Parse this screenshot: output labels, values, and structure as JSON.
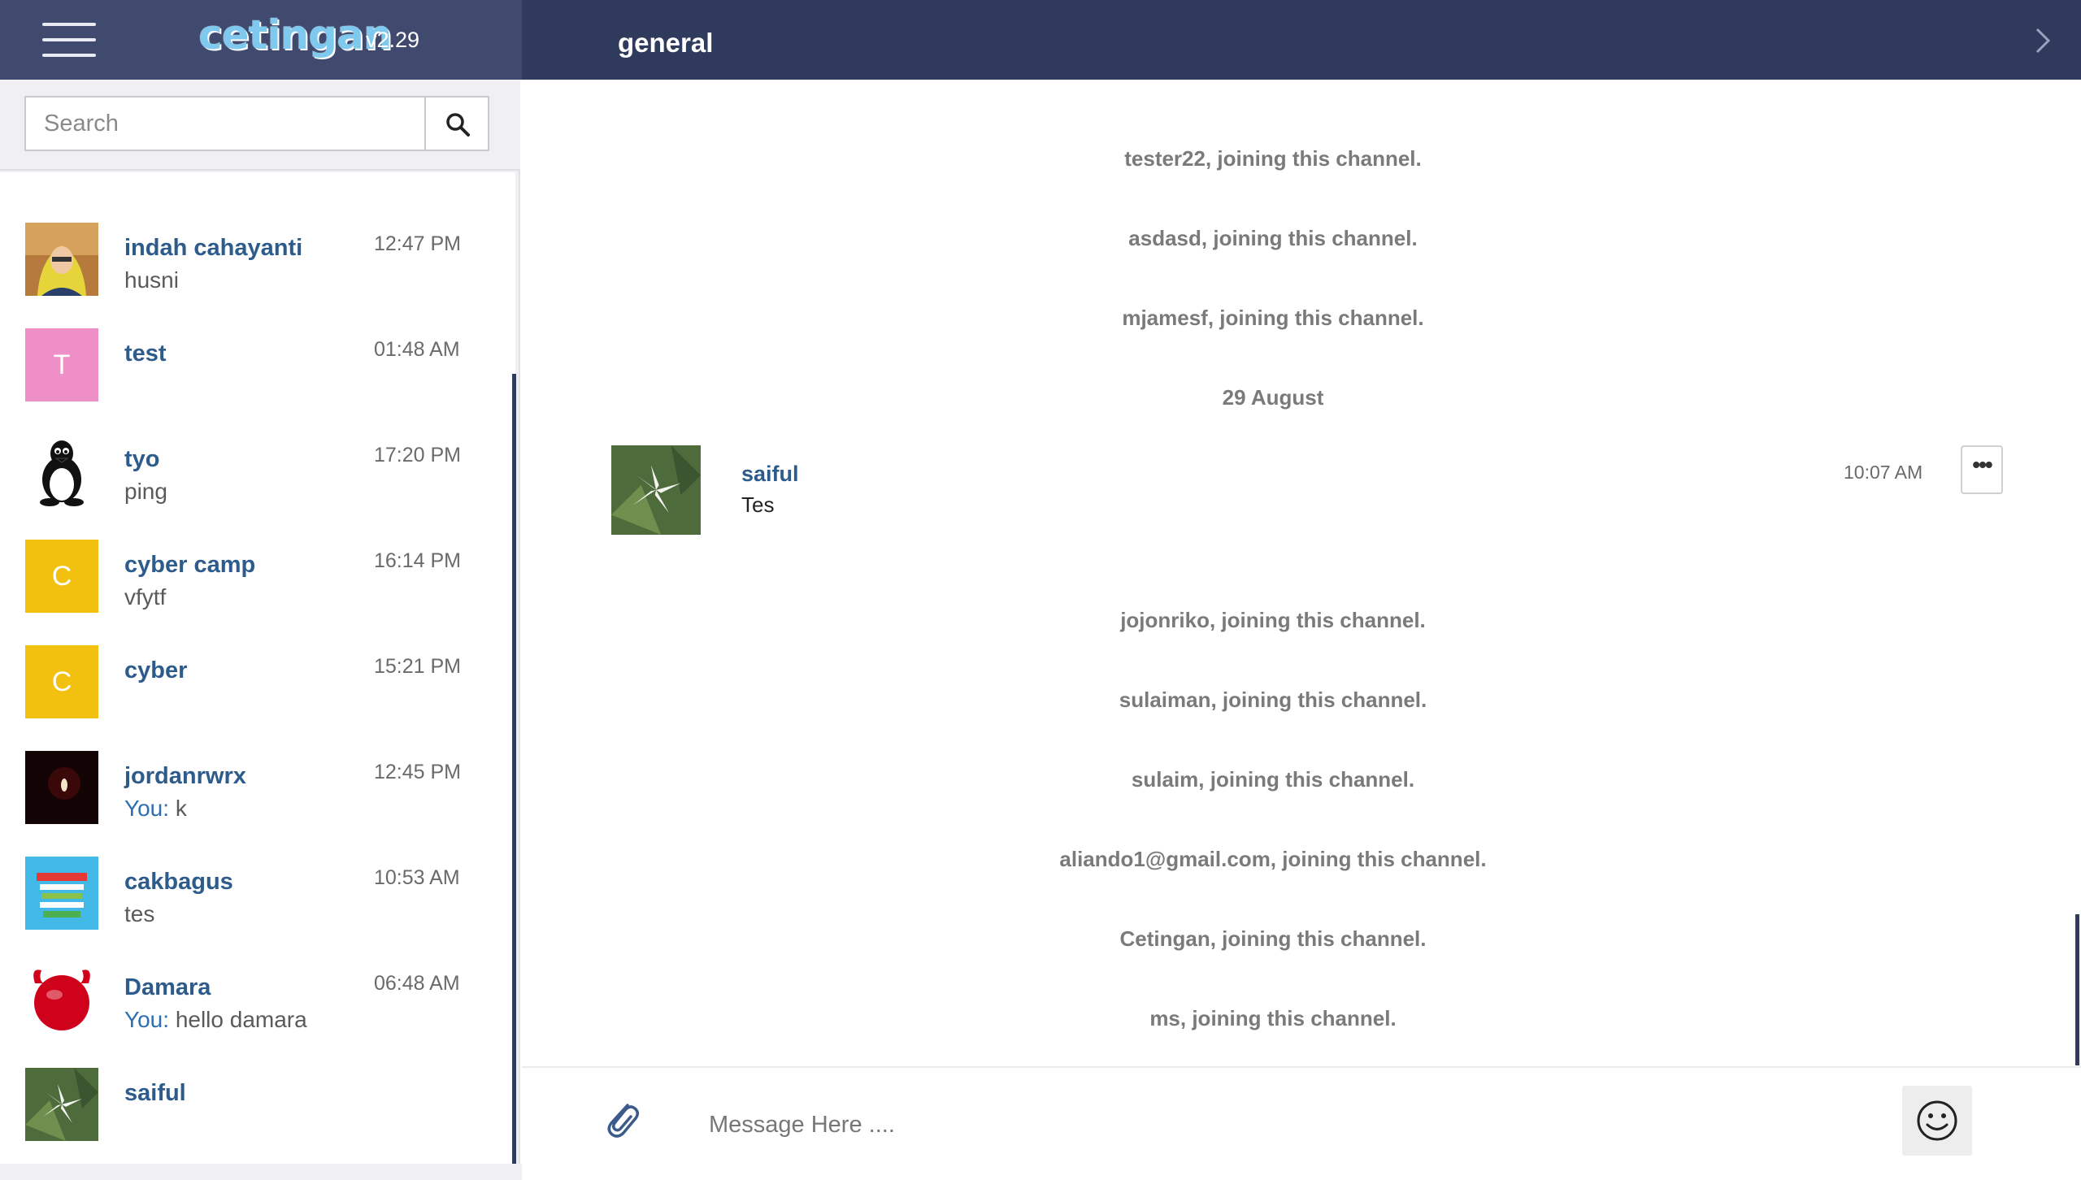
{
  "brand": {
    "name": "cetingan",
    "version": "v2.29"
  },
  "search": {
    "placeholder": "Search"
  },
  "conversations": [
    {
      "name": "indah cahayanti",
      "preview": "husni",
      "you": "",
      "time": "12:47 PM",
      "avatar": "photo"
    },
    {
      "name": "test",
      "preview": "",
      "you": "",
      "time": "01:48 AM",
      "avatar": "letter",
      "letter": "T",
      "color": "#ef8fc7"
    },
    {
      "name": "tyo",
      "preview": "ping",
      "you": "",
      "time": "17:20 PM",
      "avatar": "tux"
    },
    {
      "name": "cyber camp",
      "preview": "vfytf",
      "you": "",
      "time": "16:14 PM",
      "avatar": "letter",
      "letter": "C",
      "color": "#f2c10f"
    },
    {
      "name": "cyber",
      "preview": "",
      "you": "",
      "time": "15:21 PM",
      "avatar": "letter",
      "letter": "C",
      "color": "#f2c10f"
    },
    {
      "name": "jordanrwrx",
      "preview": "k",
      "you": "You:",
      "time": "12:45 PM",
      "avatar": "dark"
    },
    {
      "name": "cakbagus",
      "preview": "tes",
      "you": "",
      "time": "10:53 AM",
      "avatar": "poster"
    },
    {
      "name": "Damara",
      "preview": "hello damara",
      "you": "You:",
      "time": "06:48 AM",
      "avatar": "devil"
    },
    {
      "name": "saiful",
      "preview": "",
      "you": "",
      "time": "",
      "avatar": "flower"
    }
  ],
  "channel": {
    "title": "general"
  },
  "system_messages_top": [
    "tester22, joining this channel.",
    "asdasd, joining this channel.",
    "mjamesf, joining this channel."
  ],
  "date_divider": "29 August",
  "message": {
    "author": "saiful",
    "text": "Tes",
    "time": "10:07 AM",
    "more": "•••"
  },
  "system_messages_bottom": [
    "jojonriko, joining this channel.",
    "sulaiman, joining this channel.",
    "sulaim, joining this channel.",
    "aliando1@gmail.com, joining this channel.",
    "Cetingan, joining this channel.",
    "ms, joining this channel."
  ],
  "composer": {
    "placeholder": "Message Here ...."
  },
  "colors": {
    "header": "#3f4a6e",
    "topbar": "#2f3a5c",
    "accent": "#2d5b8b"
  }
}
